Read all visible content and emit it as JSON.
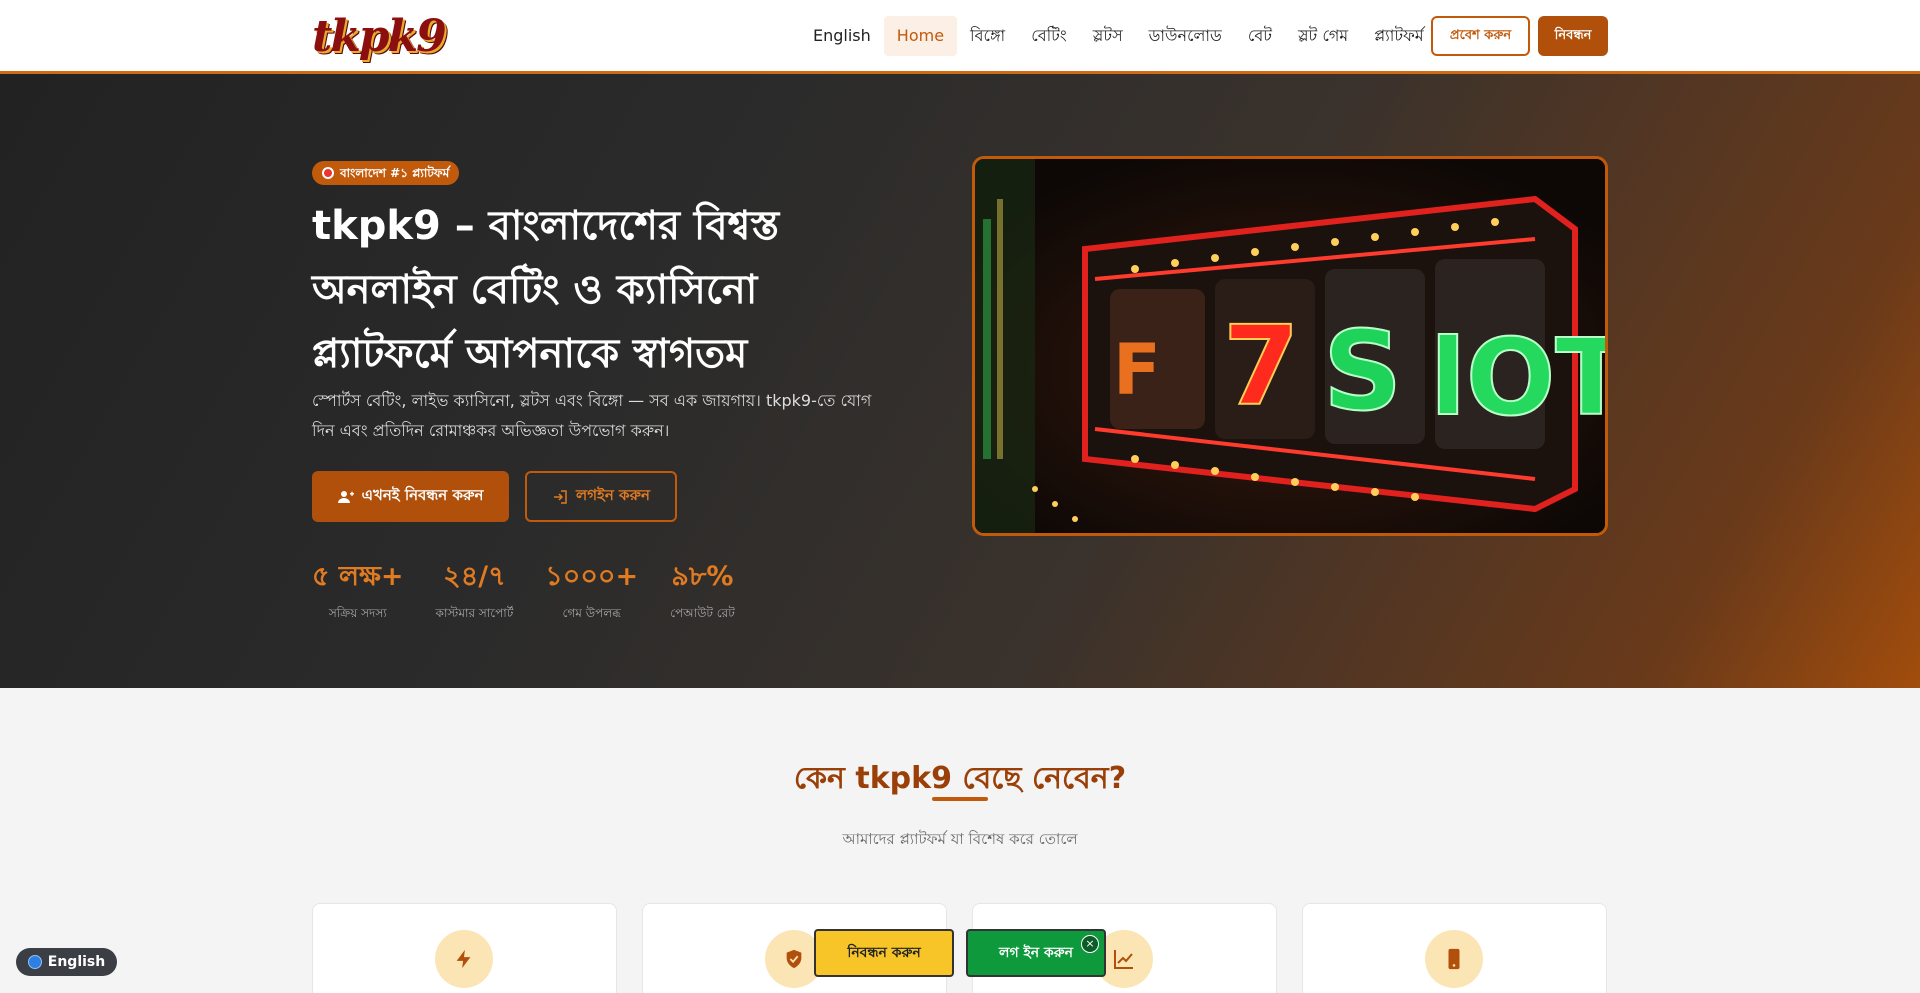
{
  "header": {
    "logo_text": "tkpk9",
    "nav": [
      "English",
      "Home",
      "বিঙ্গো",
      "বেটিং",
      "স্লটস",
      "ডাউনলোড",
      "বেট",
      "স্লট গেম",
      "প্ল্যাটফর্ম"
    ],
    "active_nav": "Home",
    "login_label": "প্রবেশ করুন",
    "register_label": "নিবন্ধন"
  },
  "hero": {
    "badge": "বাংলাদেশ #১ প্ল্যাটফর্ম",
    "title": "tkpk9 – বাংলাদেশের বিশ্বস্ত অনলাইন বেটিং ও ক্যাসিনো প্ল্যাটফর্মে আপনাকে স্বাগতম",
    "subtitle": "স্পোর্টস বেটিং, লাইভ ক্যাসিনো, স্লটস এবং বিঙ্গো — সব এক জায়গায়। tkpk9-তে যোগ দিন এবং প্রতিদিন রোমাঞ্চকর অভিজ্ঞতা উপভোগ করুন।",
    "register_btn": "এখনই নিবন্ধন করুন",
    "login_btn": "লগইন করুন",
    "stats": [
      {
        "value": "৫ লক্ষ+",
        "label": "সক্রিয় সদস্য"
      },
      {
        "value": "২৪/৭",
        "label": "কাস্টমার সাপোর্ট"
      },
      {
        "value": "১০০০+",
        "label": "গেম উপলব্ধ"
      },
      {
        "value": "৯৮%",
        "label": "পেআউট রেট"
      }
    ],
    "image_text": "7 Slot"
  },
  "section": {
    "title": "কেন tkpk9 বেছে নেবেন?",
    "subtitle": "আমাদের প্ল্যাটফর্ম যা বিশেষ করে তোলে",
    "card_icons": [
      "bolt-icon",
      "shield-icon",
      "chart-icon",
      "mobile-icon"
    ]
  },
  "floating": {
    "language": "English",
    "register": "নিবন্ধন করুন",
    "login": "লগ ইন করুন",
    "close": "×"
  },
  "colors": {
    "accent": "#c25a0c",
    "dark_accent": "#b0500b",
    "stat": "#e07b22",
    "hero_bg": "#2b2b2b",
    "float_register": "#f7c527",
    "float_login": "#0e9a3c"
  }
}
